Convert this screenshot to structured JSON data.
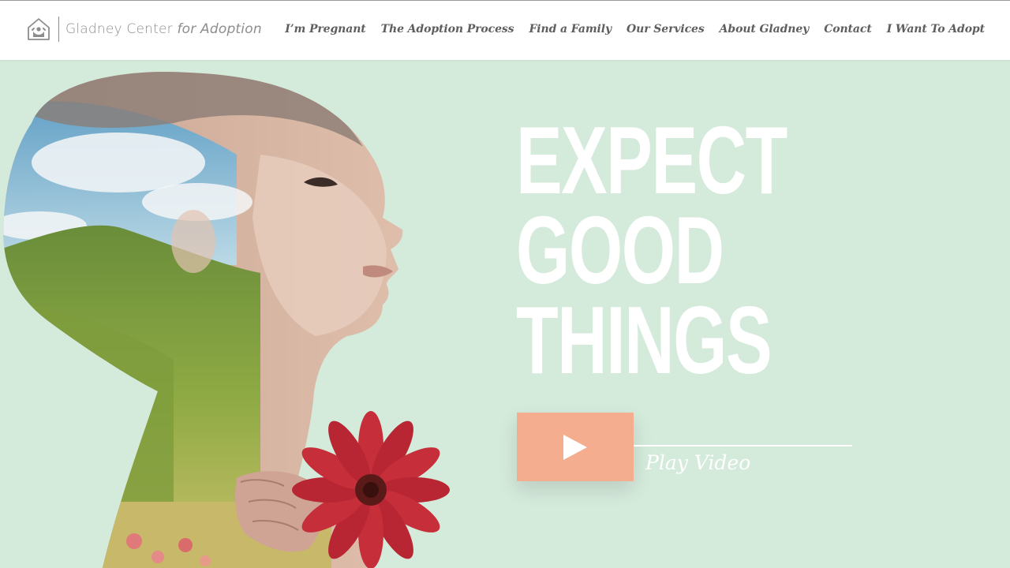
{
  "header": {
    "logo": {
      "name": "Gladney Center",
      "tagline": "for Adoption",
      "icon": "house-with-family-icon"
    },
    "nav": [
      {
        "label": "I’m Pregnant"
      },
      {
        "label": "The Adoption Process"
      },
      {
        "label": "Find a Family"
      },
      {
        "label": "Our Services"
      },
      {
        "label": "About Gladney"
      },
      {
        "label": "Contact"
      },
      {
        "label": "I Want To Adopt"
      }
    ]
  },
  "hero": {
    "headline_lines": [
      "EXPECT",
      "GOOD",
      "THINGS"
    ],
    "play": {
      "label": "Play Video",
      "icon": "play-icon"
    }
  },
  "colors": {
    "background": "#d4eadb",
    "header_bg": "#ffffff",
    "nav_text": "#5e5e5e",
    "logo_text": "#8d8d8d",
    "accent": "#f4ad8e",
    "headline": "#ffffff"
  }
}
